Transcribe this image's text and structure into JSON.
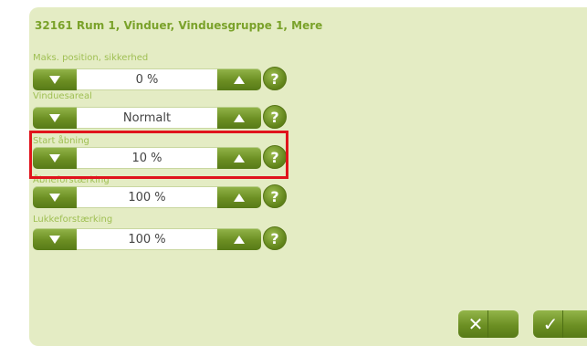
{
  "title": "32161 Rum 1, Vinduer, Vinduesgruppe 1, Mere",
  "rows": [
    {
      "label": "Maks. position, sikkerhed",
      "value": "0 %"
    },
    {
      "label": "Vinduesareal",
      "value": "Normalt"
    },
    {
      "label": "Start åbning",
      "value": "10 %"
    },
    {
      "label": "Åbneforstærking",
      "value": "100 %"
    },
    {
      "label": "Lukkeforstærking",
      "value": "100 %"
    }
  ],
  "help_glyph": "?",
  "footer": {
    "cancel_glyph": "✕",
    "ok_glyph": "✓"
  },
  "colors": {
    "accent": "#6c8f23",
    "panel": "#e4ecc4",
    "highlight": "#e0141c"
  }
}
